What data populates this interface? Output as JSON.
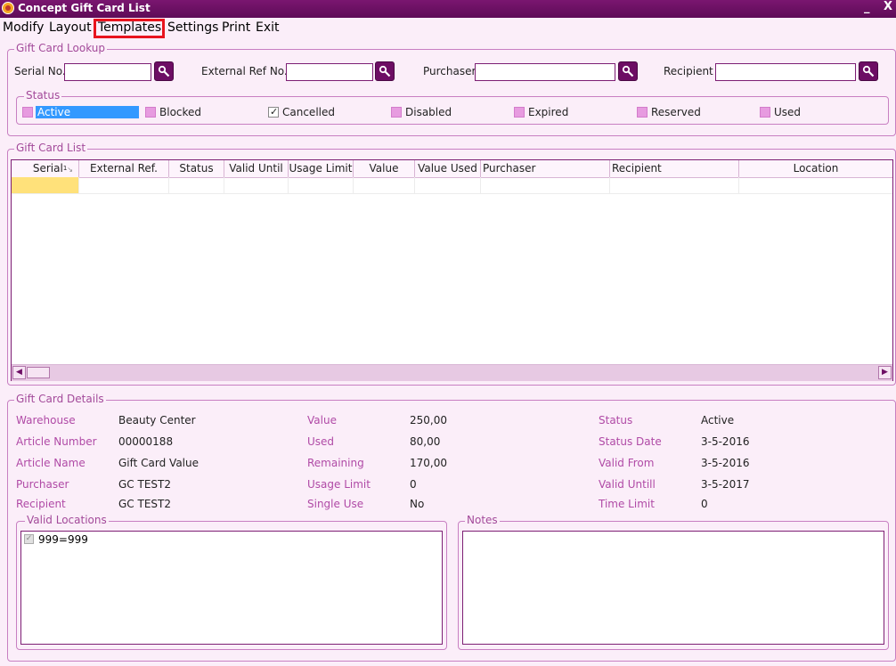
{
  "window": {
    "title": "Concept Gift Card List",
    "min_glyph": "_",
    "close_glyph": "X"
  },
  "menu": {
    "modify": "Modify",
    "layout": "Layout",
    "templates": "Templates",
    "settings": "Settings",
    "print": "Print",
    "exit": "Exit"
  },
  "lookup": {
    "legend": "Gift Card Lookup",
    "serial_label": "Serial No.",
    "serial_value": "",
    "external_label": "External Ref No.",
    "external_value": "",
    "purchaser_label": "Purchaser",
    "purchaser_value": "",
    "recipient_label": "Recipient",
    "recipient_value": "",
    "status_legend": "Status",
    "statuses": [
      {
        "label": "Active",
        "checked": false,
        "selected": true
      },
      {
        "label": "Blocked",
        "checked": false
      },
      {
        "label": "Cancelled",
        "checked": true
      },
      {
        "label": "Disabled",
        "checked": false
      },
      {
        "label": "Expired",
        "checked": false
      },
      {
        "label": "Reserved",
        "checked": false
      },
      {
        "label": "Used",
        "checked": false
      }
    ]
  },
  "list": {
    "legend": "Gift Card List",
    "columns": [
      "Serial",
      "External Ref.",
      "Status",
      "Valid Until",
      "Usage Limit",
      "Value",
      "Value Used",
      "Purchaser",
      "Recipient",
      "Location"
    ],
    "sort_indicator": "1",
    "rows": [
      [
        "",
        "",
        "",
        "",
        "",
        "",
        "",
        "",
        "",
        ""
      ]
    ]
  },
  "details": {
    "legend": "Gift Card Details",
    "warehouse_label": "Warehouse",
    "warehouse_value": "Beauty Center",
    "article_number_label": "Article Number",
    "article_number_value": "00000188",
    "article_name_label": "Article Name",
    "article_name_value": "Gift Card Value",
    "purchaser_label": "Purchaser",
    "purchaser_value": "GC TEST2",
    "recipient_label": "Recipient",
    "recipient_value": "GC TEST2",
    "value_label": "Value",
    "value_value": "250,00",
    "used_label": "Used",
    "used_value": "80,00",
    "remaining_label": "Remaining",
    "remaining_value": "170,00",
    "usage_limit_label": "Usage Limit",
    "usage_limit_value": "0",
    "single_use_label": "Single Use",
    "single_use_value": "No",
    "status_label": "Status",
    "status_value": "Active",
    "status_date_label": "Status Date",
    "status_date_value": "3-5-2016",
    "valid_from_label": "Valid From",
    "valid_from_value": "3-5-2016",
    "valid_untill_label": "Valid Untill",
    "valid_untill_value": "3-5-2017",
    "time_limit_label": "Time Limit",
    "time_limit_value": "0",
    "valid_locations_legend": "Valid Locations",
    "valid_locations": [
      {
        "label": "999=999",
        "checked": true
      }
    ],
    "notes_legend": "Notes",
    "notes_value": ""
  }
}
